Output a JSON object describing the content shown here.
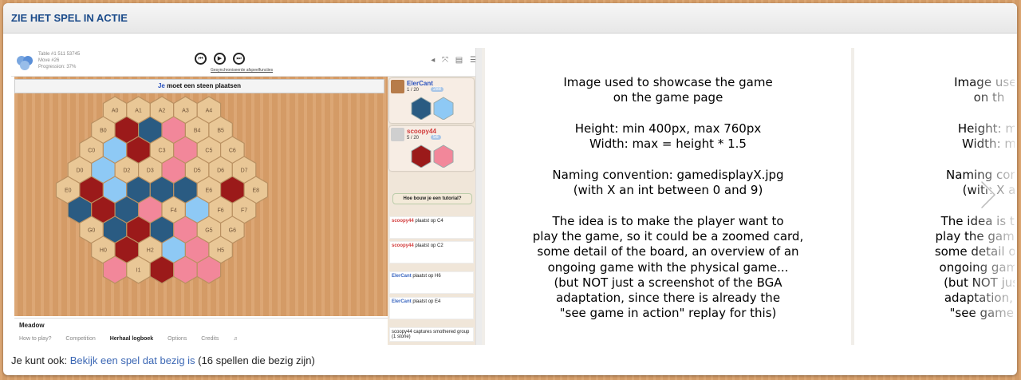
{
  "section": {
    "title": "ZIE HET SPEL IN ACTIE"
  },
  "carousel": {
    "placeholder_lines": [
      "Image used to showcase the game",
      "on the game page",
      "",
      "Height: min 400px, max 760px",
      "Width: max = height * 1.5",
      "",
      "Naming convention: gamedisplayX.jpg",
      "(with X an int between 0 and 9)",
      "",
      "The idea is to make the player want to",
      "play the game, so it could be a zoomed card,",
      "some detail of the board, an overview of an",
      "ongoing game with the physical game...",
      "(but NOT just a screenshot of the BGA",
      "adaptation, since there is already the",
      "\"see game in action\" replay for this)"
    ],
    "placeholder_lines_partial": [
      "Image used",
      "on th",
      "",
      "Height: mi",
      "Width: m",
      "",
      "Naming conve",
      "(with X a",
      "",
      "The idea is to m",
      "play the game, so",
      "some detail of the",
      "ongoing game w",
      "(but NOT just a",
      "adaptation, sin",
      "\"see game in"
    ],
    "next_icon": "chevron-right-icon"
  },
  "game": {
    "meta": [
      "Table #1 511 53745",
      "Move #26",
      "Progression: 37%"
    ],
    "controls_label": "Gesynchroniseerde afspeelfuncties",
    "banner_player": "Je",
    "banner_rest": "moet een steen plaatsen",
    "players": [
      {
        "name": "ElerCant",
        "score": "1 / 20",
        "badge": "288",
        "name_color": "#2a52be"
      },
      {
        "name": "scoopy44",
        "score": "5 / 20",
        "badge": "56",
        "name_color": "#d23b3b"
      }
    ],
    "tutorial": "Hoe bouw je een tutorial?",
    "log": [
      {
        "player": "scoopy44",
        "text": "plaatst",
        "target": "op C4",
        "cls": "pl"
      },
      {
        "player": "scoopy44",
        "text": "plaatst",
        "target": "op C2",
        "cls": "pl"
      },
      {
        "player": "ElerCant",
        "text": "plaatst",
        "target": "op H6",
        "cls": "pb"
      },
      {
        "player": "ElerCant",
        "text": "plaatst",
        "target": "op E4",
        "cls": "pb"
      }
    ],
    "captures": [
      "scoopy44 captures smothered group (1 stone)",
      "scoopy44 captures smothered group (1 stone)",
      "scoopy44 captures smothered"
    ],
    "bottom_title": "Meadow",
    "bottom_tabs": [
      "How to play?",
      "Competition",
      "Herhaal logboek",
      "Options",
      "Credits",
      "♬"
    ],
    "colors": {
      "dark_red": "#9b1a1a",
      "pink": "#f2879a",
      "dark_blue": "#2a5b82",
      "light_blue": "#8ec9f5",
      "tan": "#e9c796"
    }
  },
  "footer": {
    "prefix": "Je kunt ook:",
    "link": "Bekijk een spel dat bezig is",
    "suffix": "(16 spellen die bezig zijn)"
  }
}
